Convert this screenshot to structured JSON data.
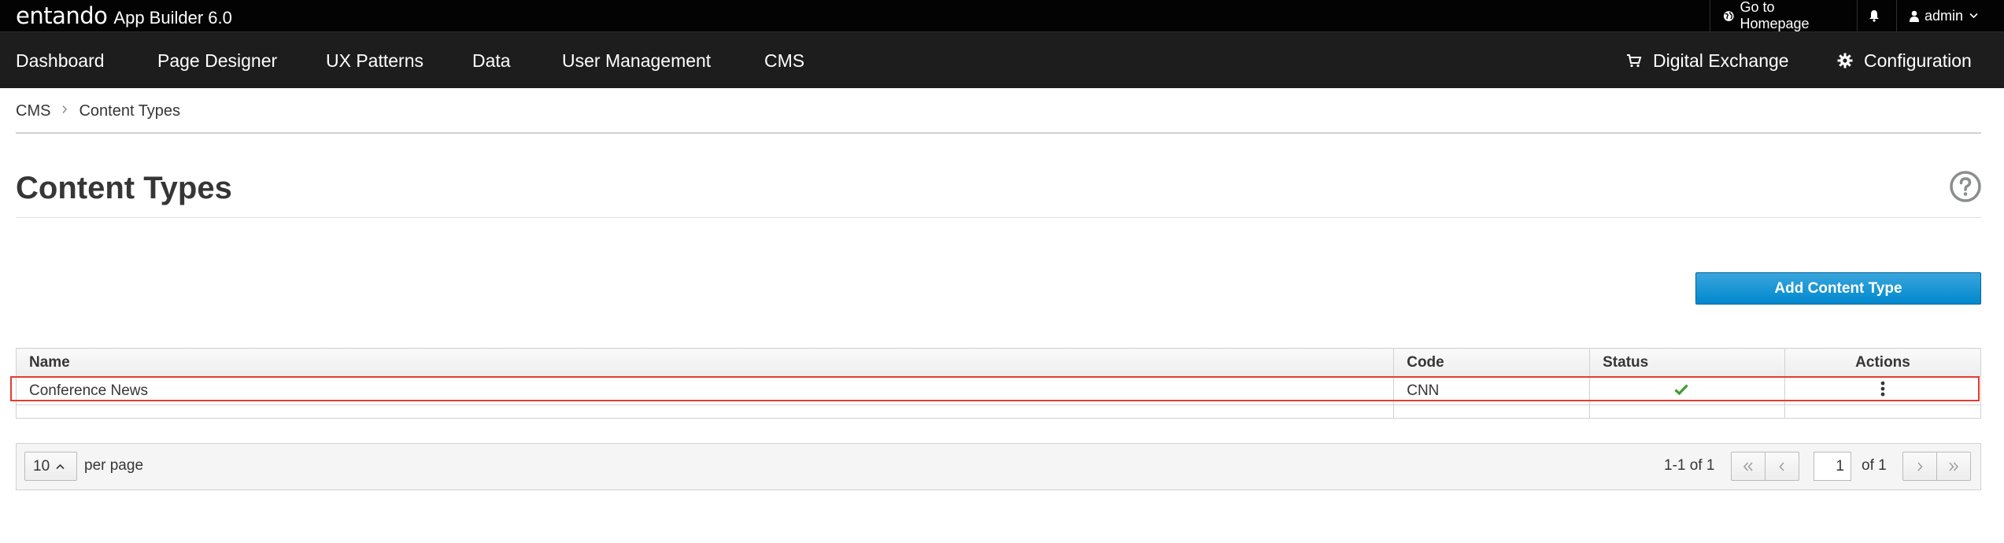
{
  "app": {
    "logo": "entando",
    "name": "App Builder 6.0"
  },
  "topbar": {
    "homepage_label": "Go to Homepage",
    "homepage_icon": "globe-icon",
    "bell_icon": "bell-icon",
    "user_label": "admin",
    "user_icon": "user-icon"
  },
  "nav": {
    "items": [
      {
        "label": "Dashboard"
      },
      {
        "label": "Page Designer"
      },
      {
        "label": "UX Patterns"
      },
      {
        "label": "Data"
      },
      {
        "label": "User Management"
      },
      {
        "label": "CMS"
      }
    ],
    "right": [
      {
        "label": "Digital Exchange",
        "icon": "cart-icon"
      },
      {
        "label": "Configuration",
        "icon": "gear-icon"
      }
    ]
  },
  "breadcrumb": {
    "items": [
      "CMS",
      "Content Types"
    ]
  },
  "page": {
    "title": "Content Types",
    "help_icon": "question-circle-icon"
  },
  "actions": {
    "add_label": "Add Content Type"
  },
  "table": {
    "columns": [
      "Name",
      "Code",
      "Status",
      "Actions"
    ],
    "rows": [
      {
        "name": "Conference News",
        "code": "CNN",
        "status": "check-icon",
        "actions": "kebab-icon"
      }
    ]
  },
  "pagination": {
    "per_page": "10",
    "per_page_label": "per page",
    "range": "1-1 of 1",
    "current_page": "1",
    "of_pages": "of 1"
  },
  "colors": {
    "topbar": "#030303",
    "navbar": "#1d1d1d",
    "primary": "#0088ce",
    "success": "#3f9c35",
    "highlight": "#e53a2f"
  }
}
